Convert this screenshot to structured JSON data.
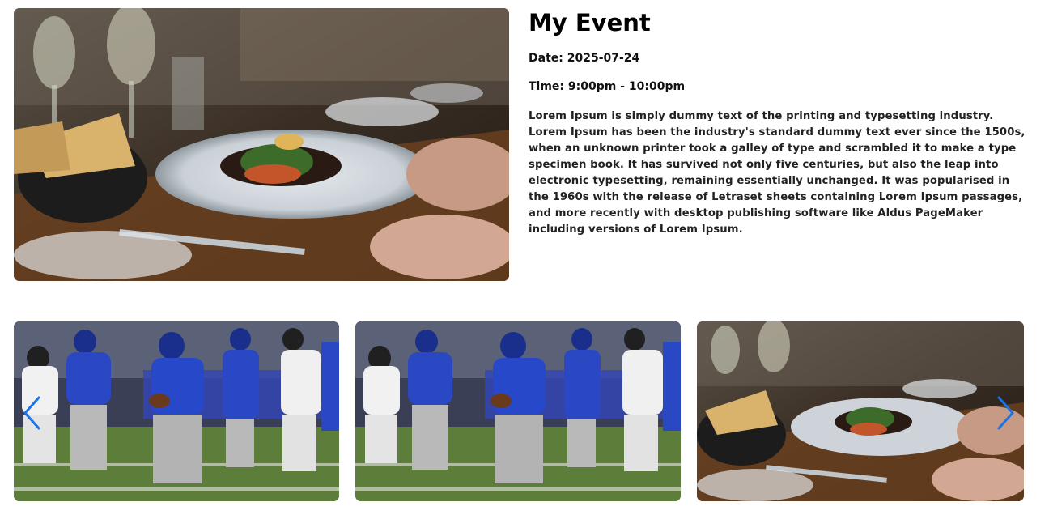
{
  "event": {
    "title": "My Event",
    "date": "Date: 2025-07-24",
    "time": "Time: 9:00pm - 10:00pm",
    "description": "Lorem Ipsum is simply dummy text of the printing and typesetting industry. Lorem Ipsum has been the industry's standard dummy text ever since the 1500s, when an unknown printer took a galley of type and scrambled it to make a type specimen book. It has survived not only five centuries, but also the leap into electronic typesetting, remaining essentially unchanged. It was popularised in the 1960s with the release of Letraset sheets containing Lorem Ipsum passages, and more recently with desktop publishing software like Aldus PageMaker including versions of Lorem Ipsum."
  },
  "hero_image": {
    "subject": "restaurant-dinner-plate"
  },
  "carousel": {
    "slides": [
      {
        "subject": "football-players"
      },
      {
        "subject": "football-players"
      },
      {
        "subject": "restaurant-dinner-plate"
      }
    ],
    "prev_icon": "chevron-left-icon",
    "next_icon": "chevron-right-icon",
    "arrow_color": "#1a73e8"
  }
}
